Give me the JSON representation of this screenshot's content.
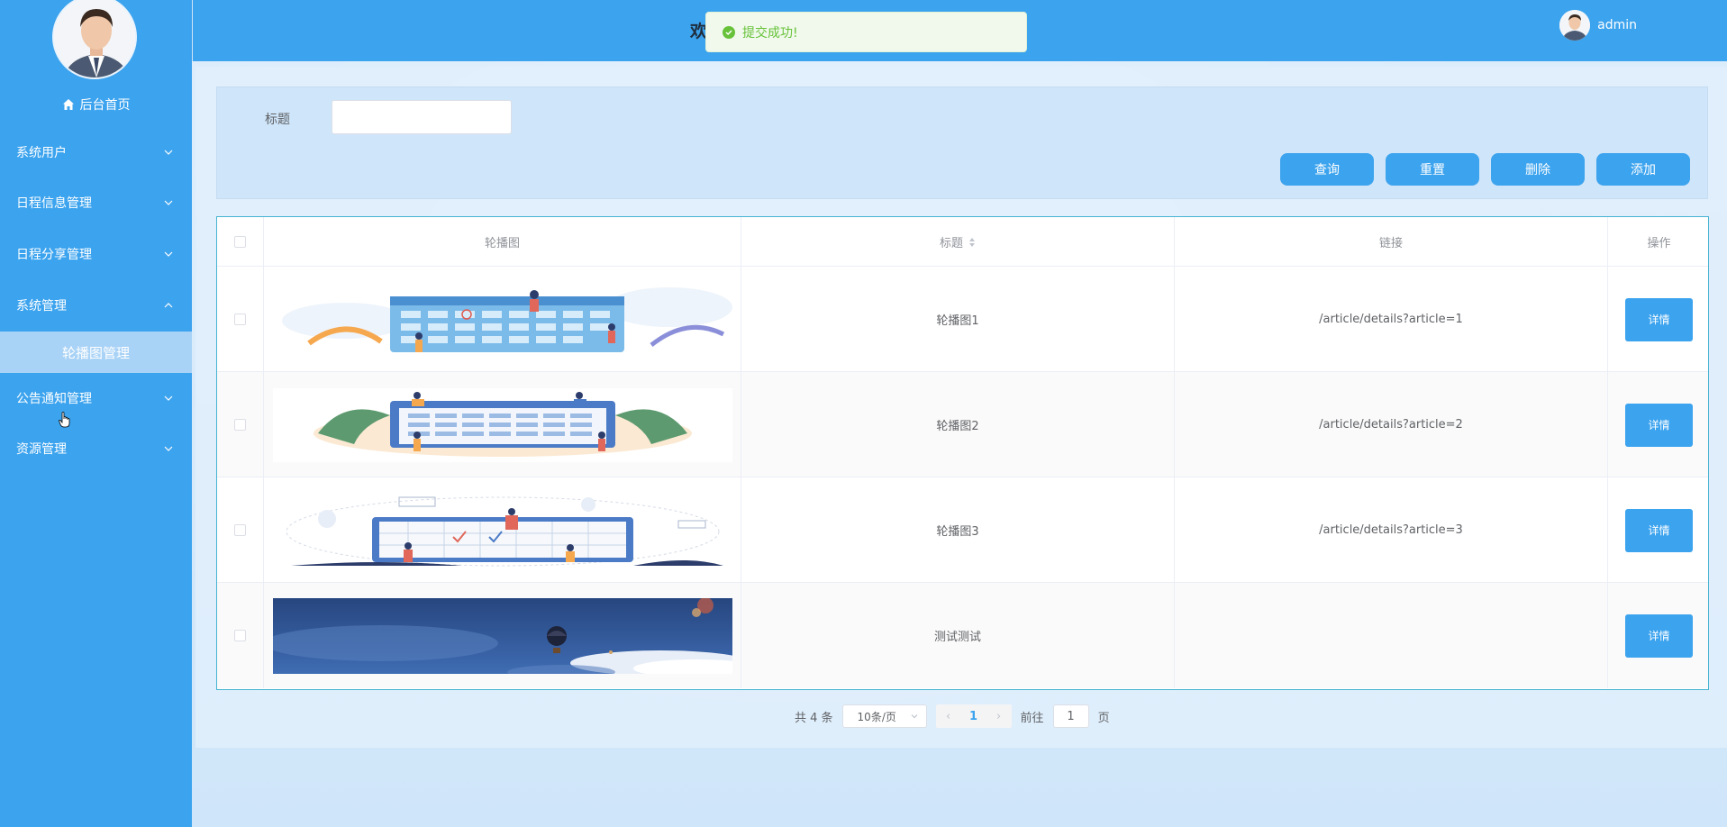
{
  "sidebar": {
    "home_label": "后台首页",
    "items": [
      {
        "label": "系统用户",
        "expanded": false
      },
      {
        "label": "日程信息管理",
        "expanded": false
      },
      {
        "label": "日程分享管理",
        "expanded": false
      },
      {
        "label": "系统管理",
        "expanded": true
      },
      {
        "label": "公告通知管理",
        "expanded": false
      },
      {
        "label": "资源管理",
        "expanded": false
      }
    ],
    "active_sub": "轮播图管理"
  },
  "header": {
    "welcome_fragment": "欢",
    "username": "admin"
  },
  "toast": {
    "message": "提交成功!",
    "type": "success"
  },
  "search": {
    "title_label": "标题",
    "title_value": ""
  },
  "actions": {
    "query": "查询",
    "reset": "重置",
    "delete": "删除",
    "add": "添加"
  },
  "table": {
    "headers": [
      "轮播图",
      "标题",
      "链接",
      "操作"
    ],
    "rows": [
      {
        "title": "轮播图1",
        "link": "/article/details?article=1",
        "action": "详情"
      },
      {
        "title": "轮播图2",
        "link": "/article/details?article=2",
        "action": "详情"
      },
      {
        "title": "轮播图3",
        "link": "/article/details?article=3",
        "action": "详情"
      },
      {
        "title": "测试测试",
        "link": "",
        "action": "详情"
      }
    ]
  },
  "pagination": {
    "total": "共 4 条",
    "page_size": "10条/页",
    "current_page": "1",
    "goto_label": "前往",
    "goto_value": "1",
    "page_suffix": "页"
  },
  "colors": {
    "primary": "#3ca3ee",
    "success": "#67c23a",
    "submenu_active": "#a8d2f6"
  }
}
